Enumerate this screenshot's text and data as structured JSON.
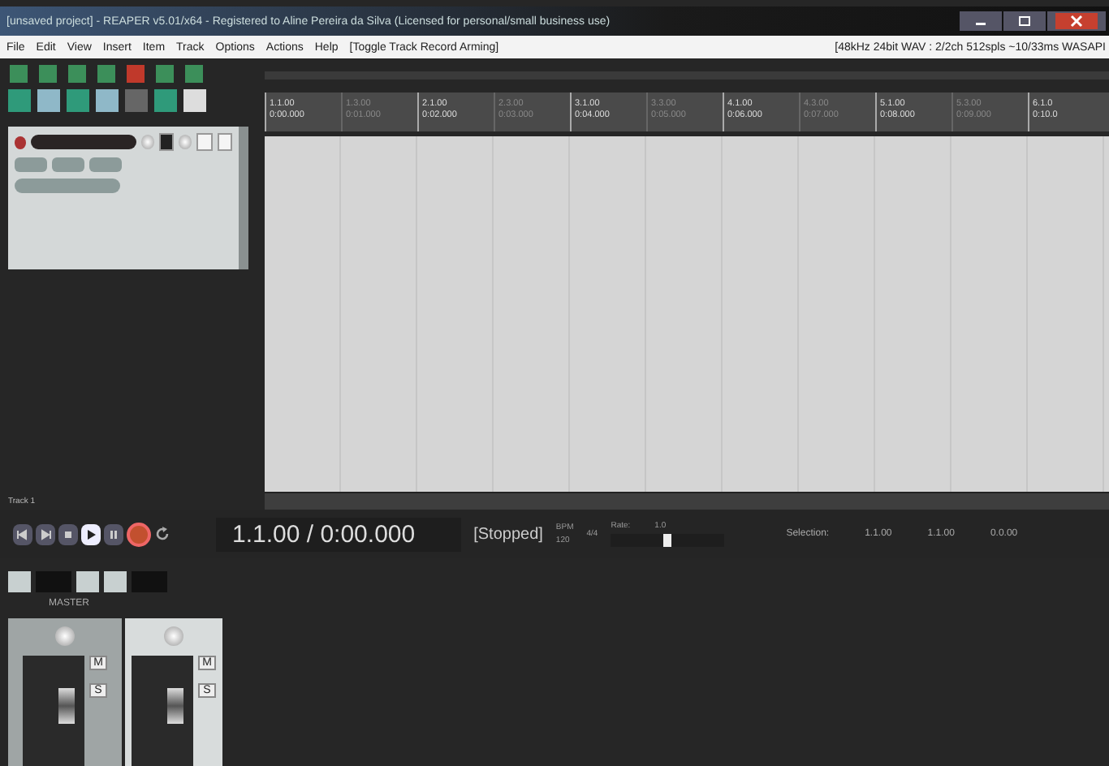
{
  "window": {
    "title": "[unsaved project] - REAPER v5.01/x64 - Registered to Aline Pereira da Silva (Licensed for personal/small business use)"
  },
  "menu": [
    "File",
    "Edit",
    "View",
    "Insert",
    "Item",
    "Track",
    "Options",
    "Actions",
    "Help",
    "[Toggle Track Record Arming]"
  ],
  "audio_status": "[48kHz 24bit WAV : 2/2ch 512spls ~10/33ms WASAPI",
  "ruler": [
    {
      "kind": "major",
      "bar": "1.1.00",
      "time": "0:00.000"
    },
    {
      "kind": "minor",
      "bar": "1.3.00",
      "time": "0:01.000"
    },
    {
      "kind": "major",
      "bar": "2.1.00",
      "time": "0:02.000"
    },
    {
      "kind": "minor",
      "bar": "2.3.00",
      "time": "0:03.000"
    },
    {
      "kind": "major",
      "bar": "3.1.00",
      "time": "0:04.000"
    },
    {
      "kind": "minor",
      "bar": "3.3.00",
      "time": "0:05.000"
    },
    {
      "kind": "major",
      "bar": "4.1.00",
      "time": "0:06.000"
    },
    {
      "kind": "minor",
      "bar": "4.3.00",
      "time": "0:07.000"
    },
    {
      "kind": "major",
      "bar": "5.1.00",
      "time": "0:08.000"
    },
    {
      "kind": "minor",
      "bar": "5.3.00",
      "time": "0:09.000"
    },
    {
      "kind": "major",
      "bar": "6.1.0",
      "time": "0:10.0"
    }
  ],
  "track_label": "Track 1",
  "transport": {
    "position": "1.1.00 / 0:00.000",
    "state": "[Stopped]",
    "bpm_label": "BPM",
    "bpm": "120",
    "signature": "4/4",
    "rate_label": "Rate:",
    "rate": "1.0",
    "level": 0.5,
    "recording": true,
    "selection_label": "Selection:",
    "selection": [
      "1.1.00",
      "1.1.00",
      "0.0.00"
    ]
  },
  "mixer": {
    "master_label": "MASTER",
    "strips": [
      {
        "mute": "M",
        "solo": "S"
      },
      {
        "mute": "M",
        "solo": "S"
      }
    ]
  }
}
